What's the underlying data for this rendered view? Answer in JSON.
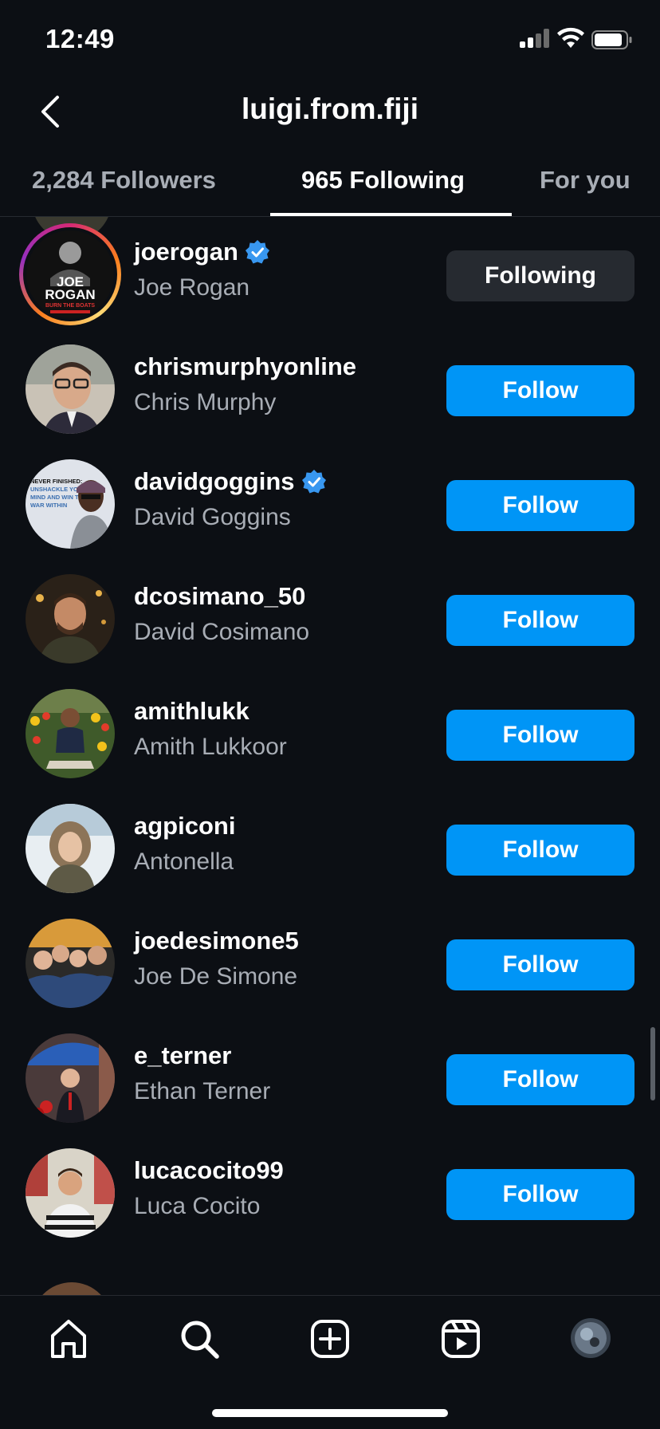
{
  "status_bar": {
    "time": "12:49"
  },
  "header": {
    "title": "luigi.from.fiji"
  },
  "tabs": [
    {
      "label": "2,284 Followers",
      "active": false
    },
    {
      "label": "965 Following",
      "active": true
    },
    {
      "label": "For you",
      "active": false
    }
  ],
  "users": [
    {
      "username": "joerogan",
      "full_name": "Joe Rogan",
      "verified": true,
      "button": "Following",
      "story_ring": true,
      "avatar_logo_line1": "JOE",
      "avatar_logo_line2": "ROGAN",
      "avatar_logo_line3": "BURN THE BOATS"
    },
    {
      "username": "chrismurphyonline",
      "full_name": "Chris Murphy",
      "verified": false,
      "button": "Follow"
    },
    {
      "username": "davidgoggins",
      "full_name": "David Goggins",
      "verified": true,
      "button": "Follow",
      "avatar_text_line1": "NEVER FINISHED:",
      "avatar_text_line2": "UNSHACKLE YOUR",
      "avatar_text_line3": "MIND AND WIN THE",
      "avatar_text_line4": "WAR WITHIN"
    },
    {
      "username": "dcosimano_50",
      "full_name": "David Cosimano",
      "verified": false,
      "button": "Follow"
    },
    {
      "username": "amithlukk",
      "full_name": "Amith Lukkoor",
      "verified": false,
      "button": "Follow"
    },
    {
      "username": "agpiconi",
      "full_name": "Antonella",
      "verified": false,
      "button": "Follow"
    },
    {
      "username": "joedesimone5",
      "full_name": "Joe De Simone",
      "verified": false,
      "button": "Follow"
    },
    {
      "username": "e_terner",
      "full_name": "Ethan Terner",
      "verified": false,
      "button": "Follow"
    },
    {
      "username": "lucacocito99",
      "full_name": "Luca Cocito",
      "verified": false,
      "button": "Follow"
    }
  ],
  "nav": {
    "items": [
      "home-icon",
      "search-icon",
      "create-icon",
      "reels-icon",
      "profile-avatar"
    ]
  },
  "colors": {
    "background": "#0c0f14",
    "follow_blue": "#0095f6",
    "following_gray": "#262a30",
    "secondary_text": "#a8adb5",
    "verified_blue": "#3897f0"
  }
}
